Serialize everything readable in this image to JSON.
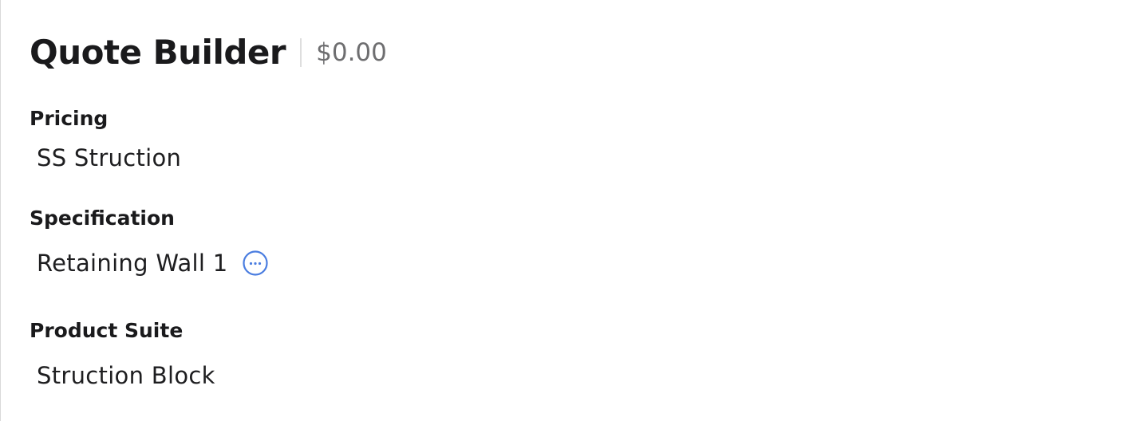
{
  "header": {
    "title": "Quote Builder",
    "total": "$0.00"
  },
  "sections": {
    "pricing": {
      "label": "Pricing",
      "value": "SS Struction"
    },
    "specification": {
      "label": "Specification",
      "value": "Retaining Wall 1",
      "action_icon": "more-options-icon"
    },
    "product_suite": {
      "label": "Product Suite",
      "value": "Struction Block"
    }
  },
  "colors": {
    "accent": "#4a7de0",
    "text_primary": "#1a1a1c",
    "text_muted": "#6e6e70",
    "divider": "#dedede"
  }
}
